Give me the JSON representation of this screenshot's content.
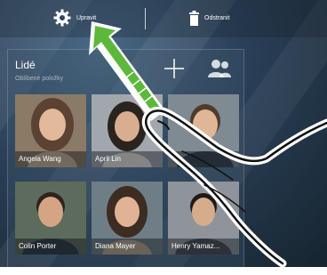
{
  "action_bar": {
    "edit_label": "Upravit",
    "remove_label": "Odstranit"
  },
  "people_widget": {
    "title": "Lidé",
    "subtitle": "Oblíbené položky",
    "contacts": [
      {
        "name": "Angela Wang"
      },
      {
        "name": "April Lin"
      },
      {
        "name": ""
      },
      {
        "name": "Colin Porter"
      },
      {
        "name": "Diana Mayer"
      },
      {
        "name": "Henry Yamaz..."
      }
    ]
  },
  "colors": {
    "gesture_arrow": "#5cb83a",
    "text": "#ffffff"
  },
  "icons": [
    "gear-icon",
    "trash-icon",
    "add-icon",
    "people-icon"
  ]
}
